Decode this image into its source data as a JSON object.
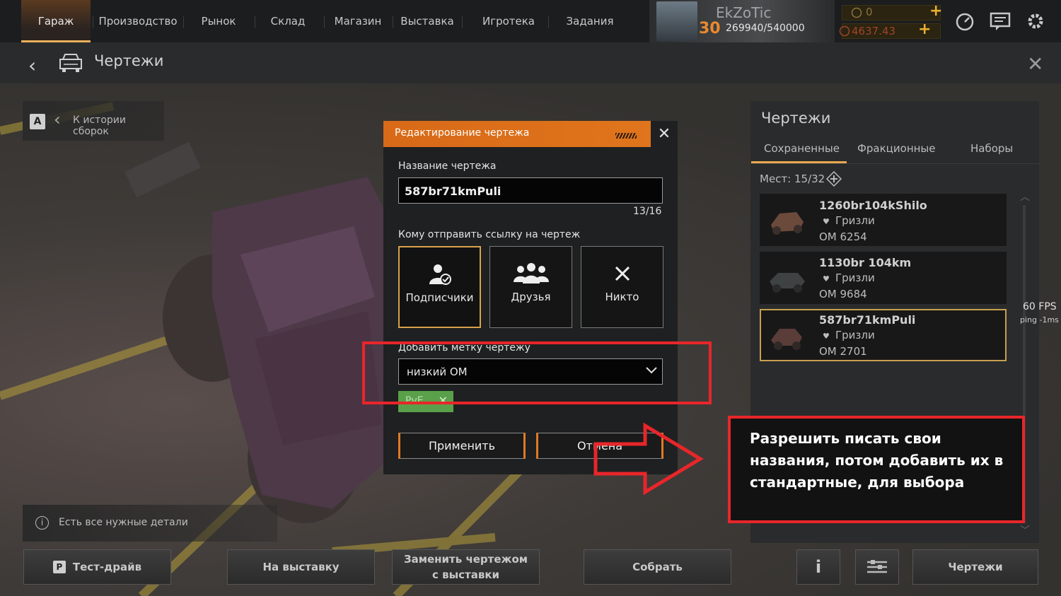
{
  "nav": {
    "items": [
      "Гараж",
      "Производство",
      "Рынок",
      "Склад",
      "Магазин",
      "Выставка",
      "Игротека",
      "Задания"
    ],
    "active": "Гараж"
  },
  "player": {
    "name": "EkZoTic",
    "level": "30",
    "experience": "269940/540000"
  },
  "currency": {
    "coins": "0",
    "crystals": "4637.43"
  },
  "header": {
    "title": "Чертежи"
  },
  "history": {
    "key": "A",
    "label": "К истории сборок"
  },
  "parts_info": {
    "label": "Есть все нужные детали"
  },
  "bottom_buttons": {
    "test_key": "P",
    "test_drive": "Тест-драйв",
    "exhibit": "На выставку",
    "replace_line1": "Заменить чертежом",
    "replace_line2": "с выставки",
    "build": "Собрать",
    "info": "i",
    "blueprints": "Чертежи"
  },
  "right_panel": {
    "title": "Чертежи",
    "tabs": [
      "Сохраненные",
      "Фракционные",
      "Наборы"
    ],
    "active_tab": "Сохраненные",
    "slots": "Мест: 15/32",
    "blueprints": [
      {
        "name": "1260br104kShilo",
        "faction": "Гризли",
        "om": "ОМ 6254",
        "selected": false
      },
      {
        "name": "1130br 104km",
        "faction": "Гризли",
        "om": "ОМ 9684",
        "selected": false
      },
      {
        "name": "587br71kmPuli",
        "faction": "Гризли",
        "om": "ОМ 2701",
        "selected": true
      }
    ]
  },
  "stats": {
    "fps": "60 FPS",
    "ping": "ping -1ms"
  },
  "modal": {
    "title": "Редактирование чертежа",
    "name_label": "Название чертежа",
    "name_value": "587br71kmPuli",
    "counter": "13/16",
    "share_label": "Кому отправить ссылку на чертеж",
    "share_options": [
      "Подписчики",
      "Друзья",
      "Никто"
    ],
    "share_selected": "Подписчики",
    "tag_label": "Добавить метку чертежу",
    "tag_value": "низкий ОМ",
    "chip_text": "PvE",
    "apply": "Применить",
    "cancel": "Отмена"
  },
  "annotation": {
    "note": "Разрешить писать свои названия, потом добавить их в стандартные, для выбора",
    "color": "#e8262a"
  },
  "colors": {
    "accent_orange": "#e0761c",
    "selected_gold": "#c8a04e",
    "chip_green": "#5aa04a"
  }
}
